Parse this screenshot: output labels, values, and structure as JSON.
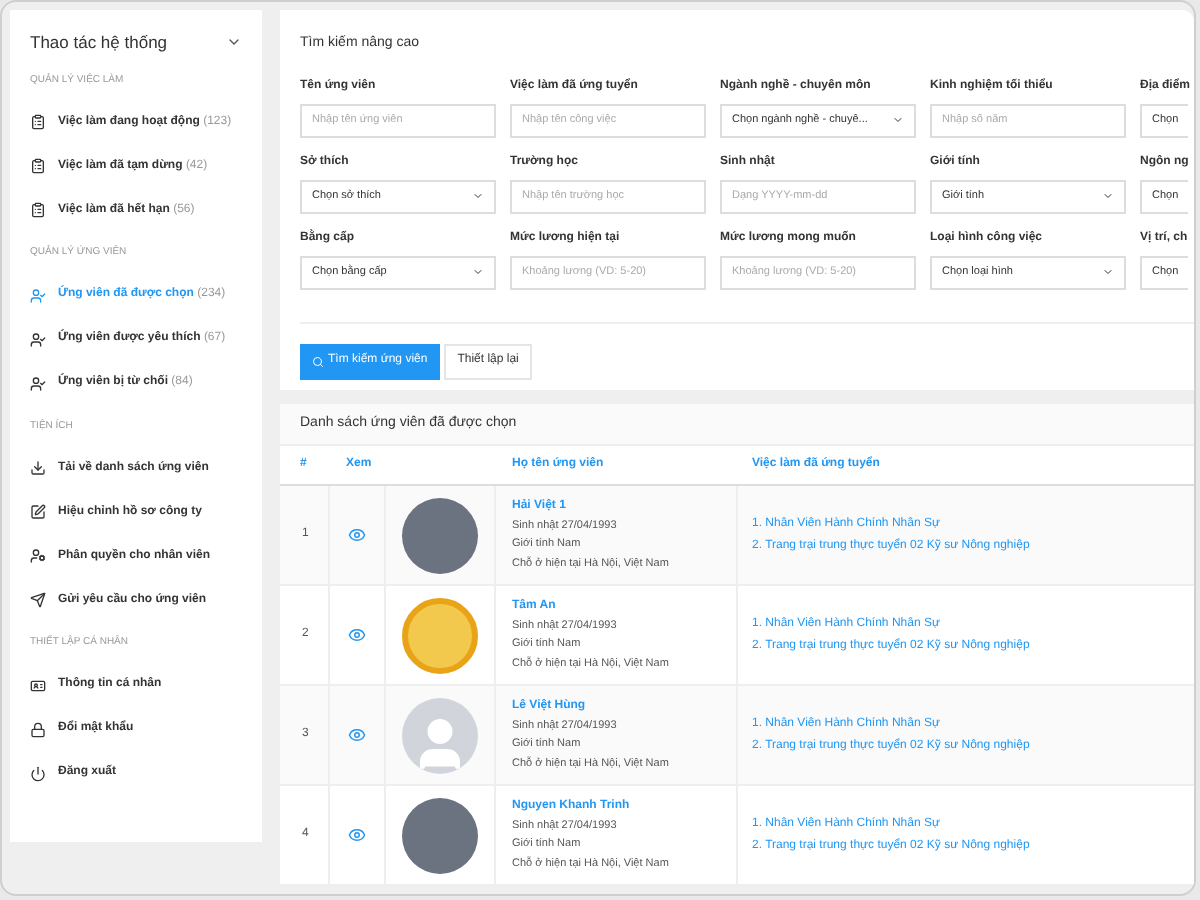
{
  "sidebar": {
    "title": "Thao tác hệ thống",
    "sections": [
      {
        "heading": "QUẢN LÝ VIỆC LÀM",
        "items": [
          {
            "label": "Việc làm đang hoạt động",
            "count": "(123)",
            "kind": "clipboard",
            "selected": false
          },
          {
            "label": "Việc làm đã tạm dừng",
            "count": "(42)",
            "kind": "clipboard",
            "selected": false
          },
          {
            "label": "Việc làm đã hết hạn",
            "count": "(56)",
            "kind": "clipboard",
            "selected": false
          }
        ]
      },
      {
        "heading": "QUẢN LÝ ỨNG VIÊN",
        "items": [
          {
            "label": "Ứng viên đã được chọn",
            "count": "(234)",
            "kind": "user",
            "selected": true
          },
          {
            "label": "Ứng viên được yêu thích",
            "count": "(67)",
            "kind": "user",
            "selected": false
          },
          {
            "label": "Ứng viên bị từ chối",
            "count": "(84)",
            "kind": "user",
            "selected": false
          }
        ]
      },
      {
        "heading": "TIỆN ÍCH",
        "items": [
          {
            "label": "Tải về danh sách ứng viên",
            "kind": "download",
            "selected": false
          },
          {
            "label": "Hiệu chỉnh hồ sơ công ty",
            "kind": "edit",
            "selected": false
          },
          {
            "label": "Phân quyền cho nhân viên",
            "kind": "permission",
            "selected": false
          },
          {
            "label": "Gửi yêu cầu cho ứng viên",
            "kind": "send",
            "selected": false
          }
        ]
      },
      {
        "heading": "THIẾT LẬP CÁ NHÂN",
        "items": [
          {
            "label": "Thông tin cá nhân",
            "kind": "profile",
            "selected": false
          },
          {
            "label": "Đổi mật khẩu",
            "kind": "password",
            "selected": false
          },
          {
            "label": "Đăng xuất",
            "kind": "logout",
            "selected": false
          }
        ]
      }
    ]
  },
  "search": {
    "title": "Tìm kiếm nâng cao",
    "fields": [
      {
        "label": "Tên ứng viên",
        "placeholder": "Nhập tên ứng viên",
        "kind": "input"
      },
      {
        "label": "Việc làm đã ứng tuyển",
        "placeholder": "Nhập tên công việc",
        "kind": "input"
      },
      {
        "label": "Ngành nghề - chuyên môn",
        "value": "Chọn ngành nghề - chuyê...",
        "kind": "select"
      },
      {
        "label": "Kinh nghiệm tối thiểu",
        "placeholder": "Nhập số năm",
        "kind": "input"
      },
      {
        "label": "Địa điểm",
        "value": "Chọn",
        "kind": "cut"
      },
      {
        "label": "Sở thích",
        "value": "Chọn sở thích",
        "kind": "select"
      },
      {
        "label": "Trường học",
        "placeholder": "Nhập tên trường học",
        "kind": "input"
      },
      {
        "label": "Sinh nhật",
        "placeholder": "Dạng YYYY-mm-dd",
        "kind": "input"
      },
      {
        "label": "Giới tính",
        "value": "Giới tính",
        "kind": "select"
      },
      {
        "label": "Ngôn ng",
        "value": "Chọn",
        "kind": "cut"
      },
      {
        "label": "Bằng cấp",
        "value": "Chọn bằng cấp",
        "kind": "select"
      },
      {
        "label": "Mức lương hiện tại",
        "placeholder": "Khoảng lương (VD: 5-20)",
        "kind": "input"
      },
      {
        "label": "Mức lương mong muốn",
        "placeholder": "Khoảng lương (VD: 5-20)",
        "kind": "input"
      },
      {
        "label": "Loại hình công việc",
        "value": "Chọn loại hình",
        "kind": "select"
      },
      {
        "label": "Vị trí, ch",
        "value": "Chọn",
        "kind": "cut"
      }
    ],
    "search_button": "Tìm kiếm ứng viên",
    "reset_button": "Thiết lập lại"
  },
  "table": {
    "title": "Danh sách ứng viên đã được chọn",
    "columns": [
      "#",
      "Xem",
      "Họ tên ứng viên",
      "Việc làm đã ứng tuyển"
    ],
    "rows": [
      {
        "index": "1",
        "kind": "photo",
        "name": "Hải Việt 1",
        "birthday": "Sinh nhật 27/04/1993",
        "gender": "Giới tính Nam",
        "address": "Chỗ ở hiện tại Hà Nội, Việt Nam",
        "jobs": [
          "1. Nhân Viên Hành Chính Nhân Sự",
          "2. Trang trại trung thực tuyển 02 Kỹ sư Nông nghiệp"
        ]
      },
      {
        "index": "2",
        "kind": "cartoon",
        "name": "Tâm An",
        "birthday": "Sinh nhật 27/04/1993",
        "gender": "Giới tính Nam",
        "address": "Chỗ ở hiện tại Hà Nội, Việt Nam",
        "jobs": [
          "1. Nhân Viên Hành Chính Nhân Sự",
          "2. Trang trại trung thực tuyển 02 Kỹ sư Nông nghiệp"
        ]
      },
      {
        "index": "3",
        "kind": "silhouette",
        "name": "Lê Việt Hùng",
        "birthday": "Sinh nhật 27/04/1993",
        "gender": "Giới tính Nam",
        "address": "Chỗ ở hiện tại Hà Nội, Việt Nam",
        "jobs": [
          "1. Nhân Viên Hành Chính Nhân Sự",
          "2. Trang trại trung thực tuyển 02 Kỹ sư Nông nghiệp"
        ]
      },
      {
        "index": "4",
        "kind": "photo",
        "name": "Nguyen Khanh Trinh",
        "birthday": "Sinh nhật 27/04/1993",
        "gender": "Giới tính Nam",
        "address": "Chỗ ở hiện tại Hà Nội, Việt Nam",
        "jobs": [
          "1. Nhân Viên Hành Chính Nhân Sự",
          "2. Trang trại trung thực tuyển 02 Kỹ sư Nông nghiệp"
        ]
      }
    ]
  }
}
